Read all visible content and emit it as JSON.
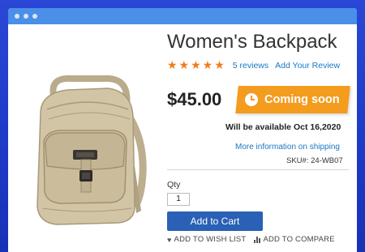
{
  "product": {
    "title": "Women's Backpack",
    "rating_stars": "★★★★★",
    "reviews_link": "5 reviews",
    "add_review_link": "Add Your Review",
    "price": "$45.00",
    "badge_label": "Coming soon",
    "availability": "Will be available Oct 16,2020",
    "shipping_link": "More information on shipping",
    "sku": "SKU#: 24-WB07",
    "image_alt": "Women's Backpack"
  },
  "purchase": {
    "qty_label": "Qty",
    "qty_value": "1",
    "add_to_cart": "Add to Cart",
    "wishlist": "ADD TO WISH LIST",
    "compare": "ADD TO COMPARE"
  },
  "colors": {
    "accent_blue": "#2a60b5",
    "link_blue": "#1979c3",
    "badge_orange": "#f39c1e",
    "star_orange": "#f07d1a"
  },
  "icons": {
    "clock": "clock-icon",
    "heart": "heart-icon",
    "compare": "compare-icon"
  }
}
